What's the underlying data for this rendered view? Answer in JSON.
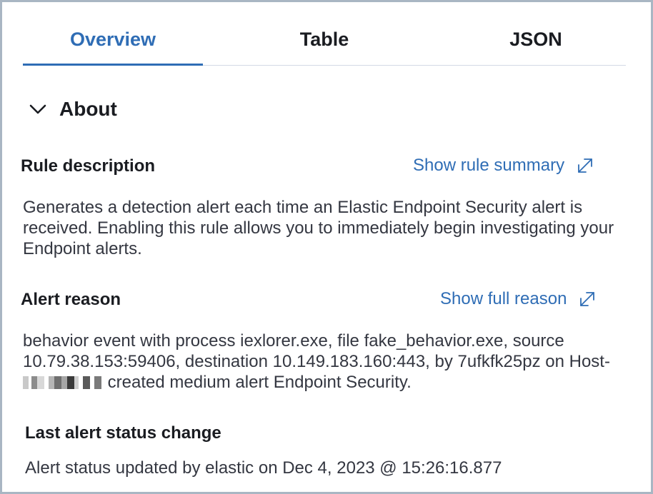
{
  "tabs": [
    {
      "label": "Overview",
      "active": true
    },
    {
      "label": "Table",
      "active": false
    },
    {
      "label": "JSON",
      "active": false
    }
  ],
  "about": {
    "label": "About",
    "expanded": true,
    "icon": "chevron-down-icon"
  },
  "rule_description": {
    "title": "Rule description",
    "link_label": "Show rule summary",
    "link_icon": "popout-icon",
    "text": "Generates a detection alert each time an Elastic Endpoint Security alert is received. Enabling this rule allows you to immediately begin investigating your Endpoint alerts."
  },
  "alert_reason": {
    "title": "Alert reason",
    "link_label": "Show full reason",
    "link_icon": "popout-icon",
    "text_before": "behavior event with process iexlorer.exe, file fake_behavior.exe, source 10.79.38.153:59406, destination 10.149.183.160:443, by 7ufkfk25pz on Host-",
    "text_after": " created medium alert Endpoint Security."
  },
  "last_status_change": {
    "title": "Last alert status change",
    "text": "Alert status updated by elastic on Dec 4, 2023 @ 15:26:16.877"
  },
  "colors": {
    "accent": "#2f6db5",
    "border": "#a9b6c3",
    "text": "#1a1c21"
  }
}
